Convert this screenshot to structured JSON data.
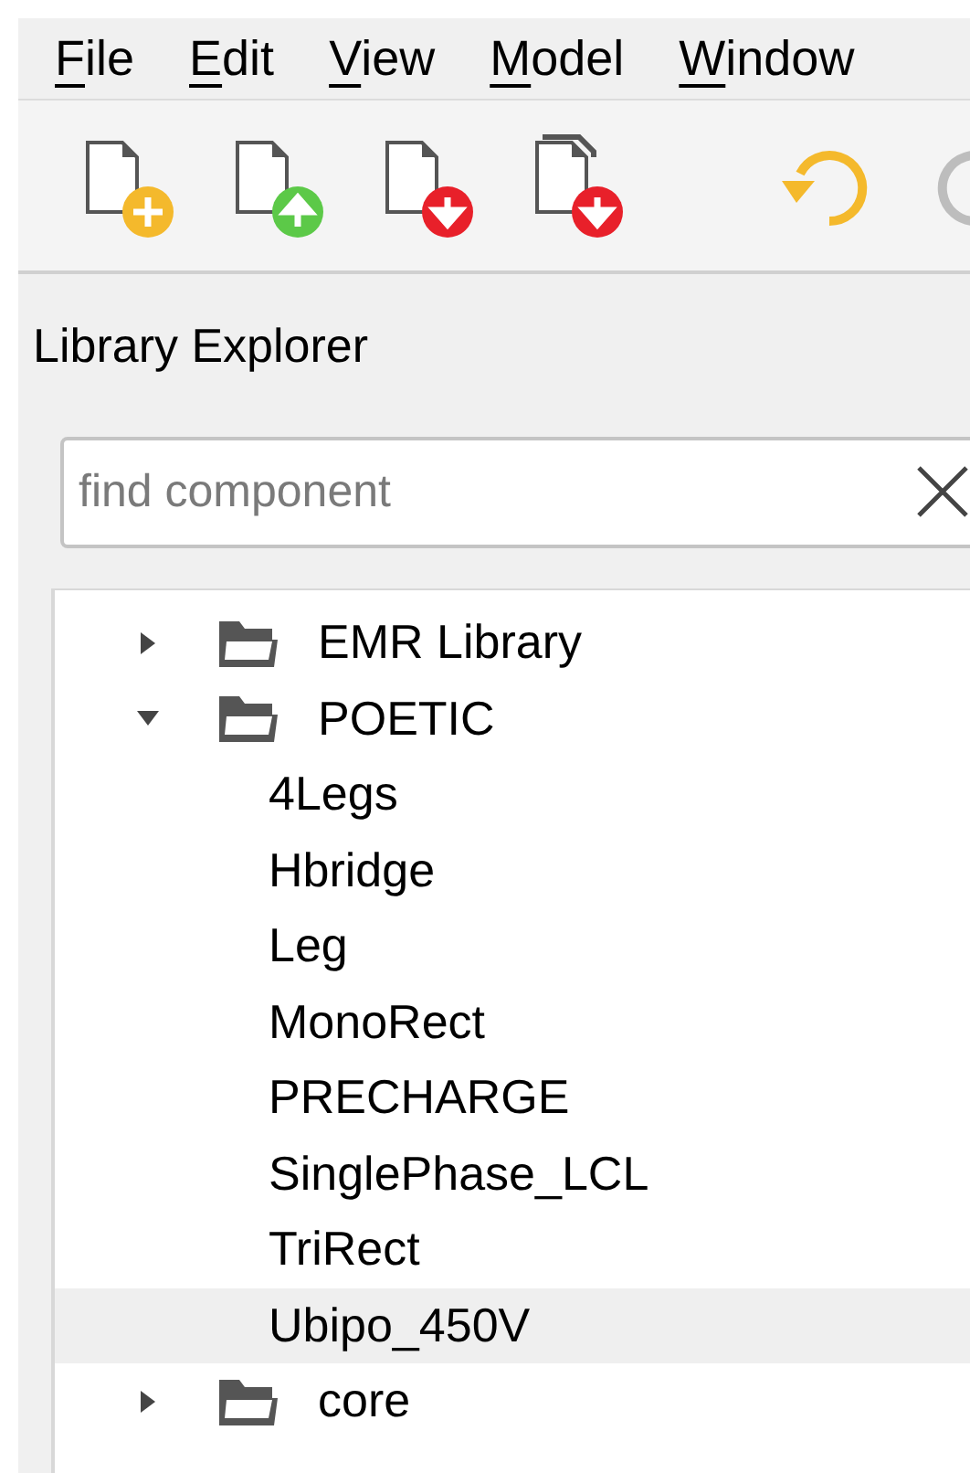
{
  "menu": [
    {
      "label": "File"
    },
    {
      "label": "Edit"
    },
    {
      "label": "View"
    },
    {
      "label": "Model"
    },
    {
      "label": "Window"
    }
  ],
  "toolbar": [
    {
      "kind": "new",
      "disabled": false
    },
    {
      "kind": "upload",
      "disabled": false
    },
    {
      "kind": "download",
      "disabled": false
    },
    {
      "kind": "download-copy",
      "disabled": false
    },
    {
      "kind": "separator"
    },
    {
      "kind": "undo",
      "disabled": false
    },
    {
      "kind": "redo",
      "disabled": true
    }
  ],
  "panel": {
    "title": "Library Explorer"
  },
  "search": {
    "placeholder": "find component"
  },
  "tree": [
    {
      "label": "EMR Library",
      "expanded": false,
      "selected": false
    },
    {
      "label": "POETIC",
      "expanded": true,
      "selected": false,
      "children": [
        {
          "label": "4Legs",
          "selected": false
        },
        {
          "label": "Hbridge",
          "selected": false
        },
        {
          "label": "Leg",
          "selected": false
        },
        {
          "label": "MonoRect",
          "selected": false
        },
        {
          "label": "PRECHARGE",
          "selected": false
        },
        {
          "label": "SinglePhase_LCL",
          "selected": false
        },
        {
          "label": "TriRect",
          "selected": false
        },
        {
          "label": "Ubipo_450V",
          "selected": true
        }
      ]
    },
    {
      "label": "core",
      "expanded": false,
      "selected": false
    }
  ]
}
